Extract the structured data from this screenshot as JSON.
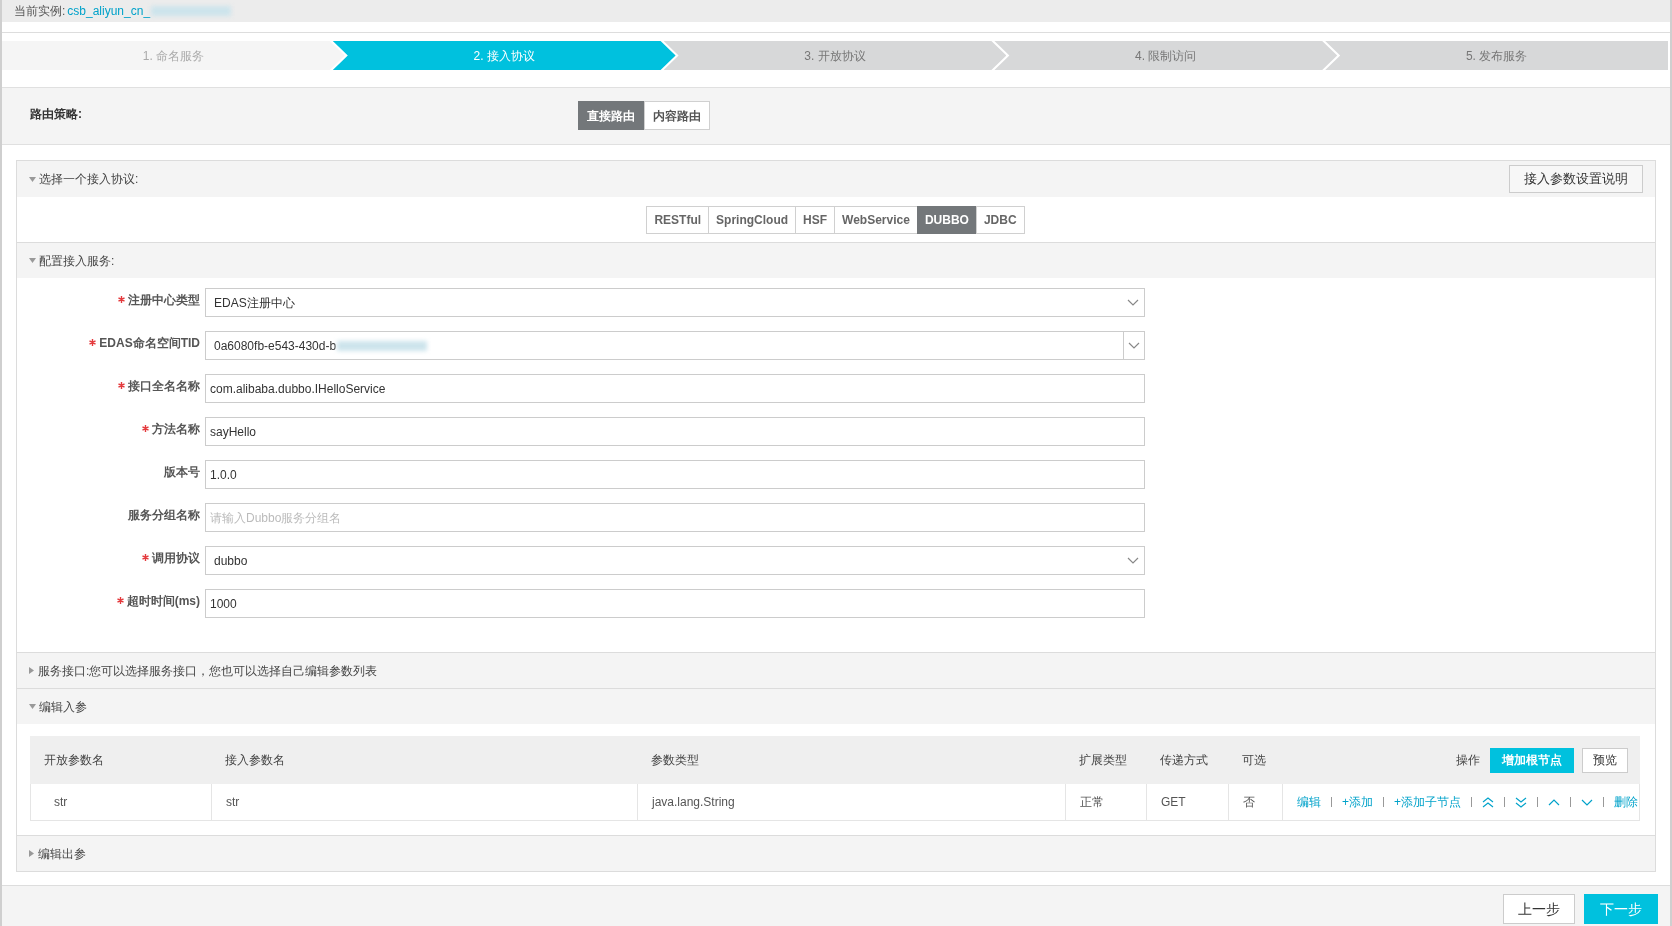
{
  "instance": {
    "label": "当前实例:",
    "value": "csb_aliyun_cn_",
    "redacted": true
  },
  "steps": [
    {
      "label": "1. 命名服务",
      "selected": false,
      "completed": true
    },
    {
      "label": "2. 接入协议",
      "selected": true,
      "completed": false
    },
    {
      "label": "3. 开放协议",
      "selected": false,
      "completed": false
    },
    {
      "label": "4. 限制访问",
      "selected": false,
      "completed": false
    },
    {
      "label": "5. 发布服务",
      "selected": false,
      "completed": false
    }
  ],
  "routing": {
    "label": "路由策略:",
    "options": [
      {
        "label": "直接路由",
        "selected": true
      },
      {
        "label": "内容路由",
        "selected": false
      }
    ]
  },
  "protocol_section": {
    "title": "选择一个接入协议:",
    "expanded": true,
    "help_button": "接入参数设置说明",
    "protocols": [
      {
        "label": "RESTful",
        "selected": false
      },
      {
        "label": "SpringCloud",
        "selected": false
      },
      {
        "label": "HSF",
        "selected": false
      },
      {
        "label": "WebService",
        "selected": false
      },
      {
        "label": "DUBBO",
        "selected": true
      },
      {
        "label": "JDBC",
        "selected": false
      }
    ]
  },
  "config_section": {
    "title": "配置接入服务:",
    "expanded": true,
    "fields": [
      {
        "label": "注册中心类型",
        "required": true,
        "kind": "select",
        "value": "EDAS注册中心"
      },
      {
        "label": "EDAS命名空间TID",
        "required": true,
        "kind": "combo",
        "value": "0a6080fb-e543-430d-b",
        "redacted": true
      },
      {
        "label": "接口全名名称",
        "required": true,
        "kind": "input",
        "value": "com.alibaba.dubbo.IHelloService"
      },
      {
        "label": "方法名称",
        "required": true,
        "kind": "input",
        "value": "sayHello"
      },
      {
        "label": "版本号",
        "required": false,
        "kind": "input",
        "value": "1.0.0"
      },
      {
        "label": "服务分组名称",
        "required": false,
        "kind": "input",
        "placeholder": "请输入Dubbo服务分组名"
      },
      {
        "label": "调用协议",
        "required": true,
        "kind": "select",
        "value": "dubbo"
      },
      {
        "label": "超时时间(ms)",
        "required": true,
        "kind": "input",
        "value": "1000"
      }
    ]
  },
  "interface_section": {
    "title": "服务接口:您可以选择服务接口，您也可以选择自己编辑参数列表",
    "expanded": false
  },
  "input_params_section": {
    "title": "编辑入参",
    "expanded": true,
    "table": {
      "columns": [
        "开放参数名",
        "接入参数名",
        "参数类型",
        "扩展类型",
        "传递方式",
        "可选",
        "操作"
      ],
      "add_root_button": "增加根节点",
      "preview_button": "预览",
      "rows": [
        {
          "cells": [
            "str",
            "str",
            "java.lang.String",
            "正常",
            "GET",
            "否"
          ],
          "actions": [
            {
              "kind": "text",
              "label": "编辑"
            },
            {
              "kind": "text",
              "label": "+添加"
            },
            {
              "kind": "text",
              "label": "+添加子节点"
            },
            {
              "kind": "top"
            },
            {
              "kind": "bottom"
            },
            {
              "kind": "up"
            },
            {
              "kind": "down"
            },
            {
              "kind": "text",
              "label": "删除"
            }
          ]
        }
      ]
    }
  },
  "output_params_section": {
    "title": "编辑出参",
    "expanded": false
  },
  "footer": {
    "prev_button": "上一步",
    "next_button": "下一步"
  }
}
